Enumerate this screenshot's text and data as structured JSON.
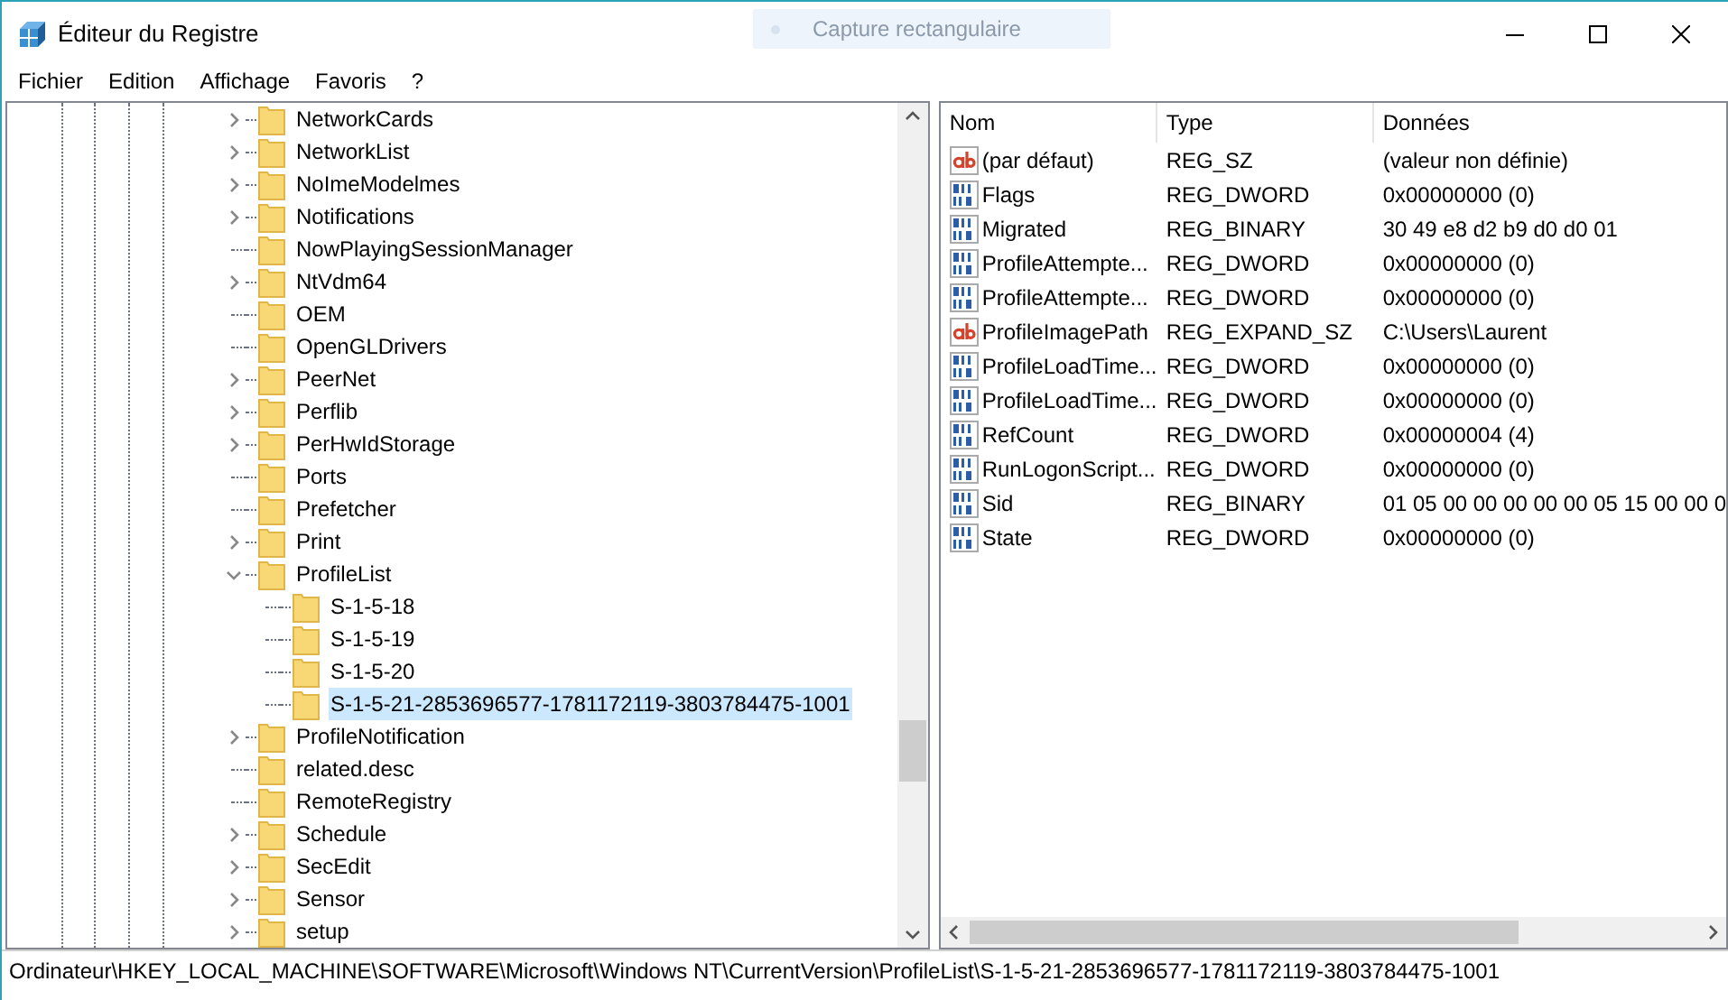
{
  "window": {
    "title": "Éditeur du Registre"
  },
  "overlay": {
    "label": "Capture rectangulaire"
  },
  "menu": [
    "Fichier",
    "Edition",
    "Affichage",
    "Favoris",
    "?"
  ],
  "tree": {
    "items": [
      {
        "name": "NetworkCards",
        "has_children": true,
        "expanded": false,
        "selected": false
      },
      {
        "name": "NetworkList",
        "has_children": true,
        "expanded": false,
        "selected": false
      },
      {
        "name": "NoImeModelmes",
        "has_children": true,
        "expanded": false,
        "selected": false
      },
      {
        "name": "Notifications",
        "has_children": true,
        "expanded": false,
        "selected": false
      },
      {
        "name": "NowPlayingSessionManager",
        "has_children": false,
        "selected": false
      },
      {
        "name": "NtVdm64",
        "has_children": true,
        "expanded": false,
        "selected": false
      },
      {
        "name": "OEM",
        "has_children": false,
        "selected": false
      },
      {
        "name": "OpenGLDrivers",
        "has_children": false,
        "selected": false
      },
      {
        "name": "PeerNet",
        "has_children": true,
        "expanded": false,
        "selected": false
      },
      {
        "name": "Perflib",
        "has_children": true,
        "expanded": false,
        "selected": false
      },
      {
        "name": "PerHwIdStorage",
        "has_children": true,
        "expanded": false,
        "selected": false
      },
      {
        "name": "Ports",
        "has_children": false,
        "selected": false
      },
      {
        "name": "Prefetcher",
        "has_children": false,
        "selected": false
      },
      {
        "name": "Print",
        "has_children": true,
        "expanded": false,
        "selected": false
      },
      {
        "name": "ProfileList",
        "has_children": true,
        "expanded": true,
        "selected": false,
        "children": [
          {
            "name": "S-1-5-18",
            "has_children": false,
            "selected": false
          },
          {
            "name": "S-1-5-19",
            "has_children": false,
            "selected": false
          },
          {
            "name": "S-1-5-20",
            "has_children": false,
            "selected": false
          },
          {
            "name": "S-1-5-21-2853696577-1781172119-3803784475-1001",
            "has_children": false,
            "selected": true
          }
        ]
      },
      {
        "name": "ProfileNotification",
        "has_children": true,
        "expanded": false,
        "selected": false
      },
      {
        "name": "related.desc",
        "has_children": false,
        "selected": false
      },
      {
        "name": "RemoteRegistry",
        "has_children": false,
        "selected": false
      },
      {
        "name": "Schedule",
        "has_children": true,
        "expanded": false,
        "selected": false
      },
      {
        "name": "SecEdit",
        "has_children": true,
        "expanded": false,
        "selected": false
      },
      {
        "name": "Sensor",
        "has_children": true,
        "expanded": false,
        "selected": false
      },
      {
        "name": "setup",
        "has_children": true,
        "expanded": false,
        "selected": false
      }
    ]
  },
  "table": {
    "columns": [
      "Nom",
      "Type",
      "Données"
    ],
    "rows": [
      {
        "kind": "string",
        "name": "(par défaut)",
        "type": "REG_SZ",
        "data": "(valeur non définie)"
      },
      {
        "kind": "binary",
        "name": "Flags",
        "type": "REG_DWORD",
        "data": "0x00000000 (0)"
      },
      {
        "kind": "binary",
        "name": "Migrated",
        "type": "REG_BINARY",
        "data": "30 49 e8 d2 b9 d0 d0 01"
      },
      {
        "kind": "binary",
        "name": "ProfileAttempte...",
        "type": "REG_DWORD",
        "data": "0x00000000 (0)"
      },
      {
        "kind": "binary",
        "name": "ProfileAttempte...",
        "type": "REG_DWORD",
        "data": "0x00000000 (0)"
      },
      {
        "kind": "string",
        "name": "ProfileImagePath",
        "type": "REG_EXPAND_SZ",
        "data": "C:\\Users\\Laurent"
      },
      {
        "kind": "binary",
        "name": "ProfileLoadTime...",
        "type": "REG_DWORD",
        "data": "0x00000000 (0)"
      },
      {
        "kind": "binary",
        "name": "ProfileLoadTime...",
        "type": "REG_DWORD",
        "data": "0x00000000 (0)"
      },
      {
        "kind": "binary",
        "name": "RefCount",
        "type": "REG_DWORD",
        "data": "0x00000004 (4)"
      },
      {
        "kind": "binary",
        "name": "RunLogonScript...",
        "type": "REG_DWORD",
        "data": "0x00000000 (0)"
      },
      {
        "kind": "binary",
        "name": "Sid",
        "type": "REG_BINARY",
        "data": "01 05 00 00 00 00 00 05 15 00 00 0"
      },
      {
        "kind": "binary",
        "name": "State",
        "type": "REG_DWORD",
        "data": "0x00000000 (0)"
      }
    ]
  },
  "status_bar": "Ordinateur\\HKEY_LOCAL_MACHINE\\SOFTWARE\\Microsoft\\Windows NT\\CurrentVersion\\ProfileList\\S-1-5-21-2853696577-1781172119-3803784475-1001"
}
